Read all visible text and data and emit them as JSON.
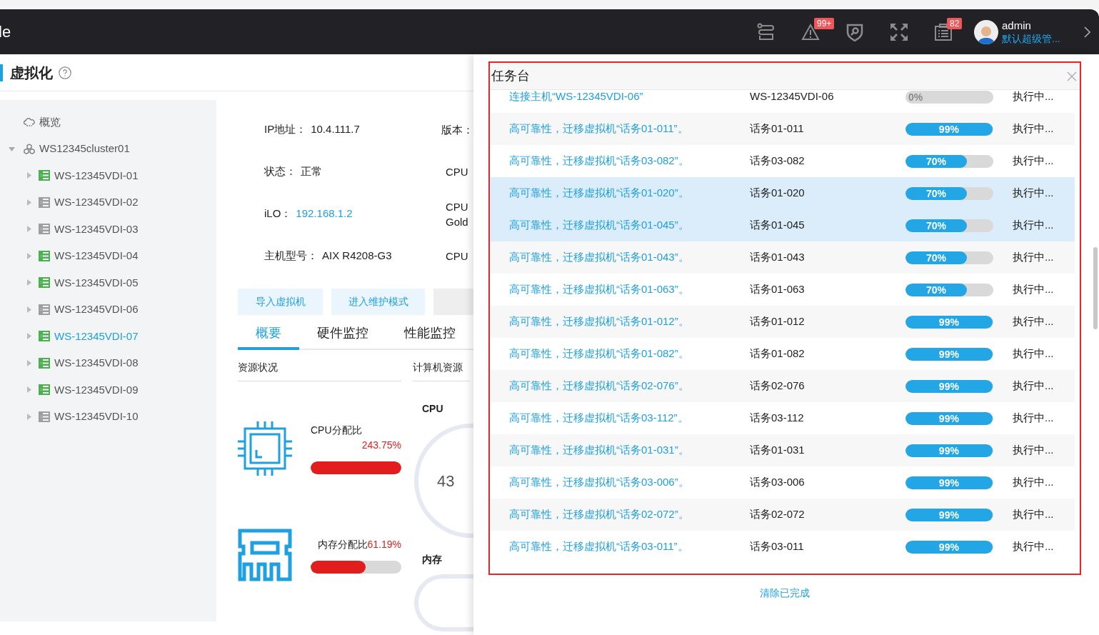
{
  "header": {
    "logo_fragment": "le",
    "badges": [
      {
        "kind": "link"
      },
      {
        "kind": "alert",
        "count": "99+"
      },
      {
        "kind": "shield"
      },
      {
        "kind": "expand"
      },
      {
        "kind": "tasks",
        "count": "82"
      }
    ],
    "user": {
      "name": "admin",
      "role": "默认超级管..."
    }
  },
  "page": {
    "title": "虚拟化"
  },
  "sidebar": {
    "items": [
      {
        "label": "概览",
        "kind": "overview"
      },
      {
        "label": "WS12345cluster01",
        "kind": "cluster",
        "expanded": true,
        "children": [
          {
            "label": "WS-12345VDI-01",
            "selected": false,
            "color": "#4caf50"
          },
          {
            "label": "WS-12345VDI-02",
            "selected": false,
            "color": "#9e9e9e"
          },
          {
            "label": "WS-12345VDI-03",
            "selected": false,
            "color": "#9e9e9e"
          },
          {
            "label": "WS-12345VDI-04",
            "selected": false,
            "color": "#4caf50"
          },
          {
            "label": "WS-12345VDI-05",
            "selected": false,
            "color": "#4caf50"
          },
          {
            "label": "WS-12345VDI-06",
            "selected": false,
            "color": "#9e9e9e"
          },
          {
            "label": "WS-12345VDI-07",
            "selected": true,
            "color": "#4caf50"
          },
          {
            "label": "WS-12345VDI-08",
            "selected": false,
            "color": "#4caf50"
          },
          {
            "label": "WS-12345VDI-09",
            "selected": false,
            "color": "#4caf50"
          },
          {
            "label": "WS-12345VDI-10",
            "selected": false,
            "color": "#9e9e9e"
          }
        ]
      }
    ]
  },
  "info": [
    {
      "label": "IP地址：",
      "value": "10.4.111.7",
      "kind": "text",
      "side_label": [
        "版本："
      ]
    },
    {
      "label": "状态：",
      "value": "正常",
      "kind": "text",
      "side_label": [
        "CPU"
      ]
    },
    {
      "label": "iLO：",
      "value": "192.168.1.2",
      "kind": "link",
      "side_label": [
        "CPU",
        "Gold"
      ]
    },
    {
      "label": "主机型号：",
      "value": "AIX R4208-G3",
      "kind": "text",
      "side_label": [
        "CPU"
      ]
    }
  ],
  "actions": [
    "导入虚拟机",
    "进入维护模式"
  ],
  "tabs": [
    {
      "label": "概要",
      "selected": true
    },
    {
      "label": "硬件监控",
      "selected": false
    },
    {
      "label": "性能监控",
      "selected": false
    }
  ],
  "resources": {
    "title": "资源状况",
    "side_title": "计算机资源",
    "items": [
      {
        "kind": "cpu",
        "label": "CPU分配比",
        "reading": "243.75%",
        "level": 1
      },
      {
        "kind": "memory",
        "label": "内存分配比",
        "reading": "61.19%",
        "level": 0.61
      }
    ],
    "gauges": [
      {
        "label": "CPU",
        "value": "43"
      },
      {
        "label": "内存"
      }
    ]
  },
  "task_panel": {
    "title": "任务台",
    "clear_label": "清除已完成",
    "tasks": [
      {
        "description": "连接主机“WS-12345VDI-06”",
        "target": "WS-12345VDI-06",
        "progress": "0%",
        "status": "执行中...",
        "highlighted": false
      },
      {
        "description": "高可靠性，迁移虚拟机“话务01-011”。",
        "target": "话务01-011",
        "progress": "99%",
        "level": 0.99,
        "status": "执行中...",
        "highlighted": false
      },
      {
        "description": "高可靠性，迁移虚拟机“话务03-082”。",
        "target": "话务03-082",
        "progress": "70%",
        "level": 0.7,
        "status": "执行中...",
        "highlighted": false
      },
      {
        "description": "高可靠性，迁移虚拟机“话务01-020”。",
        "target": "话务01-020",
        "progress": "70%",
        "level": 0.7,
        "status": "执行中...",
        "highlighted": true
      },
      {
        "description": "高可靠性，迁移虚拟机“话务01-045”。",
        "target": "话务01-045",
        "progress": "70%",
        "level": 0.7,
        "status": "执行中...",
        "highlighted": true
      },
      {
        "description": "高可靠性，迁移虚拟机“话务01-043”。",
        "target": "话务01-043",
        "progress": "70%",
        "level": 0.7,
        "status": "执行中...",
        "highlighted": false
      },
      {
        "description": "高可靠性，迁移虚拟机“话务01-063”。",
        "target": "话务01-063",
        "progress": "70%",
        "level": 0.7,
        "status": "执行中...",
        "highlighted": false
      },
      {
        "description": "高可靠性，迁移虚拟机“话务01-012”。",
        "target": "话务01-012",
        "progress": "99%",
        "level": 0.99,
        "status": "执行中...",
        "highlighted": false
      },
      {
        "description": "高可靠性，迁移虚拟机“话务01-082”。",
        "target": "话务01-082",
        "progress": "99%",
        "level": 0.99,
        "status": "执行中...",
        "highlighted": false
      },
      {
        "description": "高可靠性，迁移虚拟机“话务02-076”。",
        "target": "话务02-076",
        "progress": "99%",
        "level": 0.99,
        "status": "执行中...",
        "highlighted": false
      },
      {
        "description": "高可靠性，迁移虚拟机“话务03-112”。",
        "target": "话务03-112",
        "progress": "99%",
        "level": 0.99,
        "status": "执行中...",
        "highlighted": false
      },
      {
        "description": "高可靠性，迁移虚拟机“话务01-031”。",
        "target": "话务01-031",
        "progress": "99%",
        "level": 0.99,
        "status": "执行中...",
        "highlighted": false
      },
      {
        "description": "高可靠性，迁移虚拟机“话务03-006”。",
        "target": "话务03-006",
        "progress": "99%",
        "level": 0.99,
        "status": "执行中...",
        "highlighted": false
      },
      {
        "description": "高可靠性，迁移虚拟机“话务02-072”。",
        "target": "话务02-072",
        "progress": "99%",
        "level": 0.99,
        "status": "执行中...",
        "highlighted": false
      },
      {
        "description": "高可靠性，迁移虚拟机“话务03-011”。",
        "target": "话务03-011",
        "progress": "99%",
        "level": 0.99,
        "status": "执行中...",
        "highlighted": false
      }
    ]
  }
}
